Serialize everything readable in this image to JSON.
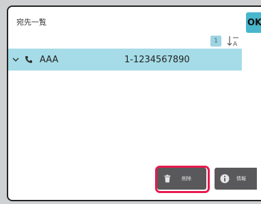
{
  "header": {
    "title": "宛先一覧",
    "ok_label": "OK"
  },
  "pagination": {
    "page": "1"
  },
  "contacts": [
    {
      "name": "AAA",
      "number": "1-1234567890"
    }
  ],
  "footer": {
    "delete_label": "削除",
    "info_label": "情報"
  },
  "colors": {
    "accent": "#48b6cd",
    "selected_row": "#a5dce7",
    "button_bg": "#59595b",
    "highlight": "#e8194e"
  },
  "icons": {
    "ok": "ok-button",
    "sort": "sort-icon",
    "expand": "chevron-down-icon",
    "phone": "phone-icon",
    "delete": "trash-icon",
    "info": "info-icon"
  }
}
